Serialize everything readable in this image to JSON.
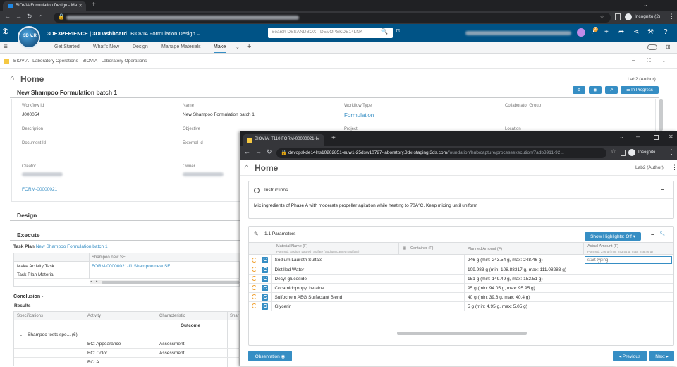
{
  "browser": {
    "tab_title": "BIOVIA Formulation Design - Ma",
    "incognito_label": "Incognito (2)"
  },
  "header": {
    "brand": "3DEXPERIENCE | 3DDashboard",
    "app_title": "BIOVIA Formulation Design",
    "search_placeholder": "Search DSSANDBOX - DEVOPSKDE14LNK",
    "notification_count": "2",
    "logo_text": "3D V,R"
  },
  "nav": {
    "items": [
      "Get Started",
      "What's New",
      "Design",
      "Manage Materials",
      "Make"
    ]
  },
  "widget": {
    "title": "BIOVIA - Laboratory Operations - BIOVIA - Laboratory Operations"
  },
  "page": {
    "home_label": "Home",
    "role": "Lab2 (Author)",
    "workflow_title": "New Shampoo Formulation batch 1",
    "status_button": "In Progress"
  },
  "fields": {
    "workflow_id_label": "Workflow Id",
    "workflow_id": "J000054",
    "name_label": "Name",
    "name": "New Shampoo Formulation batch 1",
    "workflow_type_label": "Workflow Type",
    "workflow_type": "Formulation",
    "collab_label": "Collaborator Group",
    "description_label": "Description",
    "objective_label": "Objective",
    "project_label": "Project",
    "location_label": "Location",
    "document_id_label": "Document Id",
    "external_id_label": "External Id",
    "creator_label": "Creator",
    "owner_label": "Owner",
    "formulation_link": "FORM-00000021"
  },
  "sections": {
    "design": "Design",
    "execute": "Execute",
    "task_plan_prefix": "Task Plan",
    "task_plan_link": "New Shampoo Formulation batch 1",
    "task_table_header": "Shampoo new SF",
    "task_rows": [
      {
        "label": "Make Activity Task",
        "value": "FORM-00000021-I1 Shampoo new SF"
      },
      {
        "label": "Task Plan Material",
        "value": ""
      }
    ],
    "conclusion": "Conclusion -",
    "results": "Results",
    "results_headers": [
      "Specifications",
      "Activity",
      "Characteristic",
      "Shar"
    ],
    "outcome": "Outcome",
    "results_group": "Shampoo tests spe... (6)",
    "results_rows": [
      {
        "activity": "BC: Appearance",
        "char": "Assessment"
      },
      {
        "activity": "BC: Color",
        "char": "Assessment"
      },
      {
        "activity": "BC: A...",
        "char": "..."
      }
    ]
  },
  "popup": {
    "tab_title": "BIOVIA: T110 FORM-00000021-I",
    "url_host": "devopskde14lns10202851-euw1-25dsw10727-laboratory.3dx-staging.3ds.com",
    "url_path": "/foundation/hub/capture/processexecution/7adb3911-92...",
    "incognito_label": "Incognito",
    "home_label": "Home",
    "role": "Lab2 (Author)",
    "instructions_title": "Instructions",
    "instructions_text": "Mix ingredients of Phase A with moderate propeller agitation while heating to 70Â°C. Keep mixing until uniform",
    "params_title": "1.1 Parameters",
    "show_highlights": "Show Highlights: Off",
    "col_material": "Material Name (F)",
    "col_material_sub": "Planned: Sodium Laureth Sulfate (Sodium Laureth Sulfate)",
    "col_container": "Container (F)",
    "col_planned": "Planned Amount (F)",
    "col_actual": "Actual Amount (F)",
    "col_actual_sub": "Planned: 246 g (min: 243.54 g, max: 248.46 g)",
    "actual_placeholder": "start typing",
    "materials": [
      {
        "name": "Sodium Laureth Sulfate",
        "planned": "246 g (min: 243.54 g, max: 248.46 g)"
      },
      {
        "name": "Distilled Water",
        "planned": "109.983 g (min: 108.88317 g, max: 111.08283 g)"
      },
      {
        "name": "Decyl glucoside",
        "planned": "151 g (min: 149.49 g, max: 152.51 g)"
      },
      {
        "name": "Cocamidopropyl betaine",
        "planned": "95 g (min: 94.05 g, max: 95.95 g)"
      },
      {
        "name": "Sulfochem AEG Surfactant Blend",
        "planned": "40 g (min: 39.6 g, max: 40.4 g)"
      },
      {
        "name": "Glycerin",
        "planned": "5 g (min: 4.95 g, max: 5.05 g)"
      }
    ],
    "observation_button": "Observation",
    "previous_button": "Previous",
    "next_button": "Next"
  }
}
